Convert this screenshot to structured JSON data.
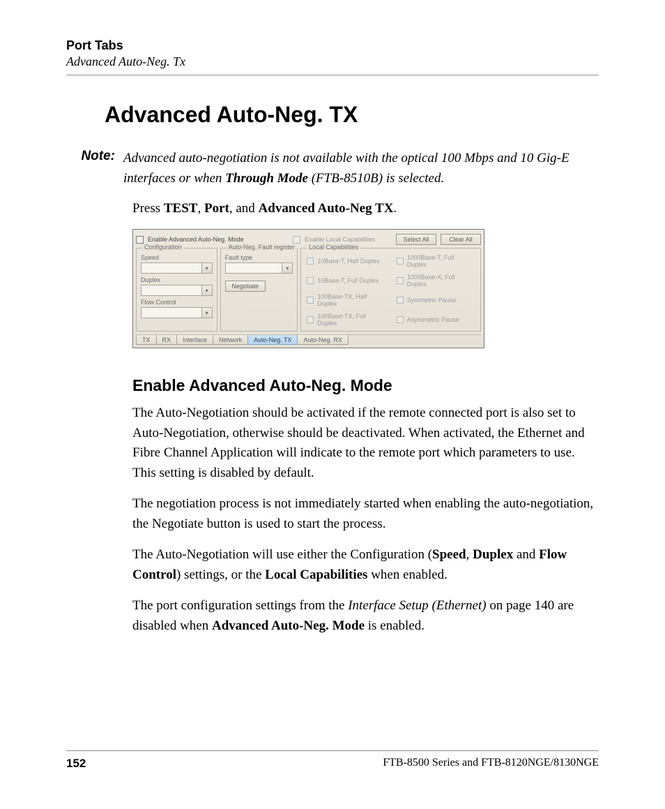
{
  "header": {
    "section": "Port Tabs",
    "subsection": "Advanced Auto-Neg. Tx"
  },
  "h1": "Advanced Auto-Neg. TX",
  "note": {
    "label": "Note:",
    "text_pre": "Advanced auto-negotiation is not available with the optical 100 Mbps and 10 Gig-E interfaces or when ",
    "bold": "Through Mode",
    "text_post": " (FTB-8510B) is selected."
  },
  "press": {
    "pre": "Press ",
    "b1": "TEST",
    "sep1": ", ",
    "b2": "Port",
    "sep2": ", and ",
    "b3": "Advanced Auto-Neg TX",
    "end": "."
  },
  "ui": {
    "enable_mode": "Enable Advanced Auto-Neg. Mode",
    "enable_local": "Enable Local Capabilities",
    "select_all": "Select All",
    "clear_all": "Clear All",
    "config": {
      "legend": "Configuration",
      "speed": "Speed",
      "duplex": "Duplex",
      "flow": "Flow Control"
    },
    "fault": {
      "legend": "Auto-Neg. Fault register",
      "type": "Fault type",
      "negotiate": "Negotiate"
    },
    "caps": {
      "legend": "Local Capabilities",
      "c1": "10Base-T, Half Duplex",
      "c2": "1000Base-T, Full Duplex",
      "c3": "10Base-T, Full Duplex",
      "c4": "1000Base-X, Full Duplex",
      "c5": "100Base-TX, Half Duplex",
      "c6": "Symmetric Pause",
      "c7": "100Base-TX, Full Duplex",
      "c8": "Asymmetric Pause"
    },
    "tabs": {
      "tx": "TX",
      "rx": "RX",
      "interface": "Interface",
      "network": "Network",
      "anegtx": "Auto-Neg. TX",
      "anegrx": "Auto-Neg. RX"
    }
  },
  "h2": "Enable Advanced Auto-Neg. Mode",
  "p1": "The Auto-Negotiation should be activated if the remote connected port is also set to Auto-Negotiation, otherwise should be deactivated. When activated, the Ethernet and Fibre Channel Application will indicate to the remote port which parameters to use. This setting is disabled by default.",
  "p2": "The negotiation process is not immediately started when enabling the auto-negotiation, the Negotiate button is used to start the process.",
  "p3": {
    "t1": "The Auto-Negotiation will use either the Configuration (",
    "b1": "Speed",
    "t2": ", ",
    "b2": "Duplex",
    "t3": " and ",
    "b3": "Flow Control",
    "t4": ") settings, or the ",
    "b4": "Local Capabilities",
    "t5": " when enabled."
  },
  "p4": {
    "t1": "The port configuration settings from the ",
    "i1": "Interface Setup (Ethernet)",
    "t2": " on page 140 are disabled when ",
    "b1": "Advanced Auto-Neg. Mode",
    "t3": " is enabled."
  },
  "footer": {
    "page": "152",
    "doc": "FTB-8500 Series and FTB-8120NGE/8130NGE"
  }
}
